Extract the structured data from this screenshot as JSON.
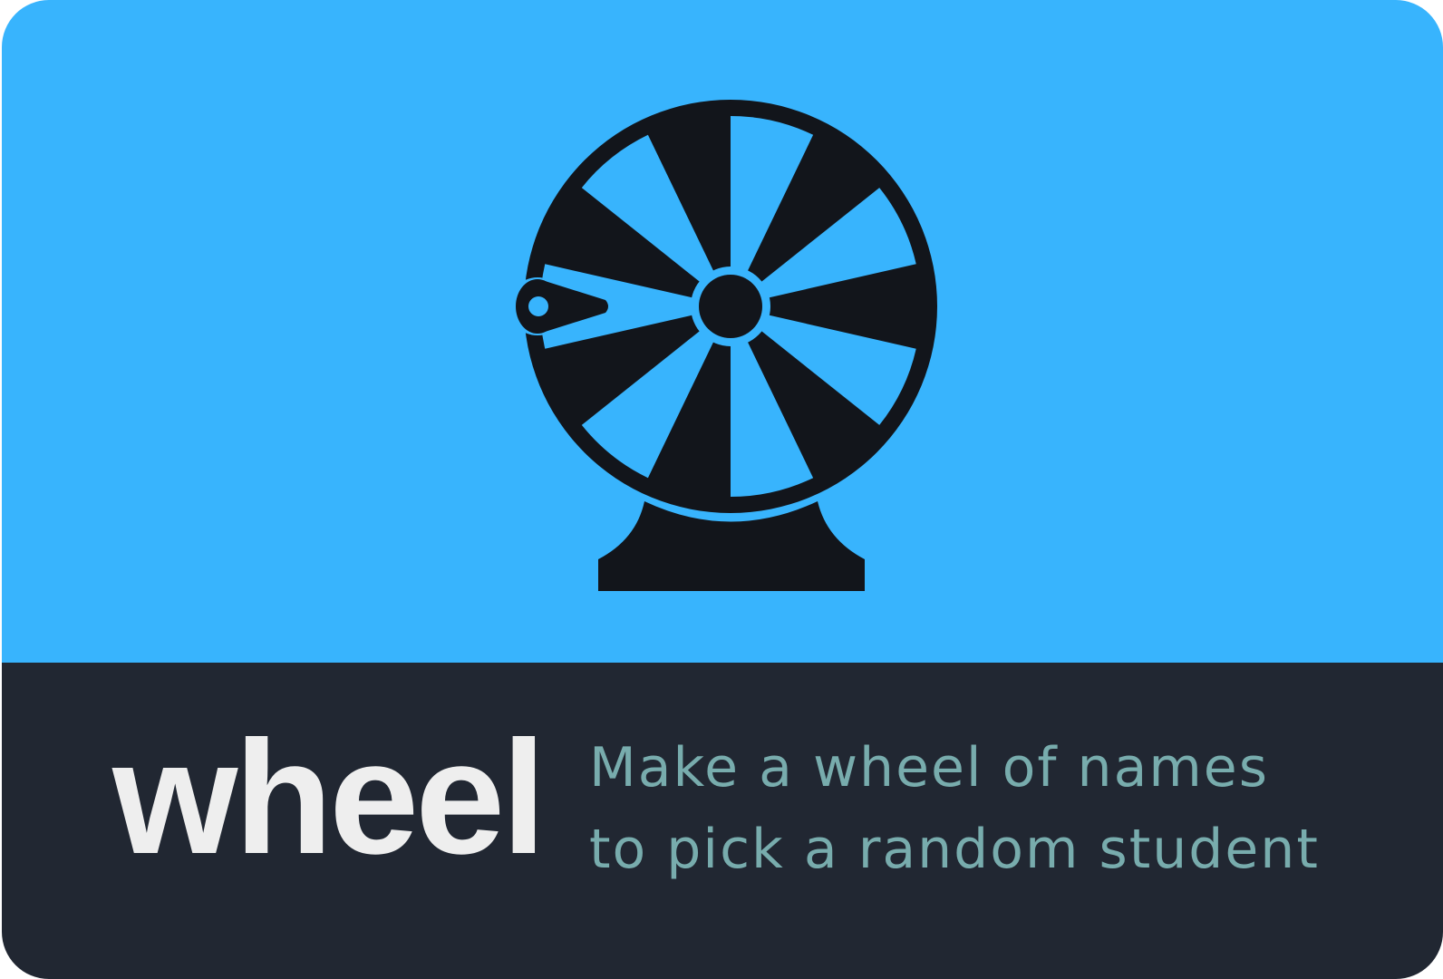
{
  "brand": {
    "title": "wheel",
    "tagline_line1": "Make a wheel of names",
    "tagline_line2": "to pick a random student"
  },
  "icons": {
    "hero": "prize-wheel-icon"
  },
  "colors": {
    "hero_background": "#38b4fd",
    "footer_background": "#212732",
    "wheel": "#12151b",
    "title": "#eeeeee",
    "tagline": "#78acad"
  }
}
